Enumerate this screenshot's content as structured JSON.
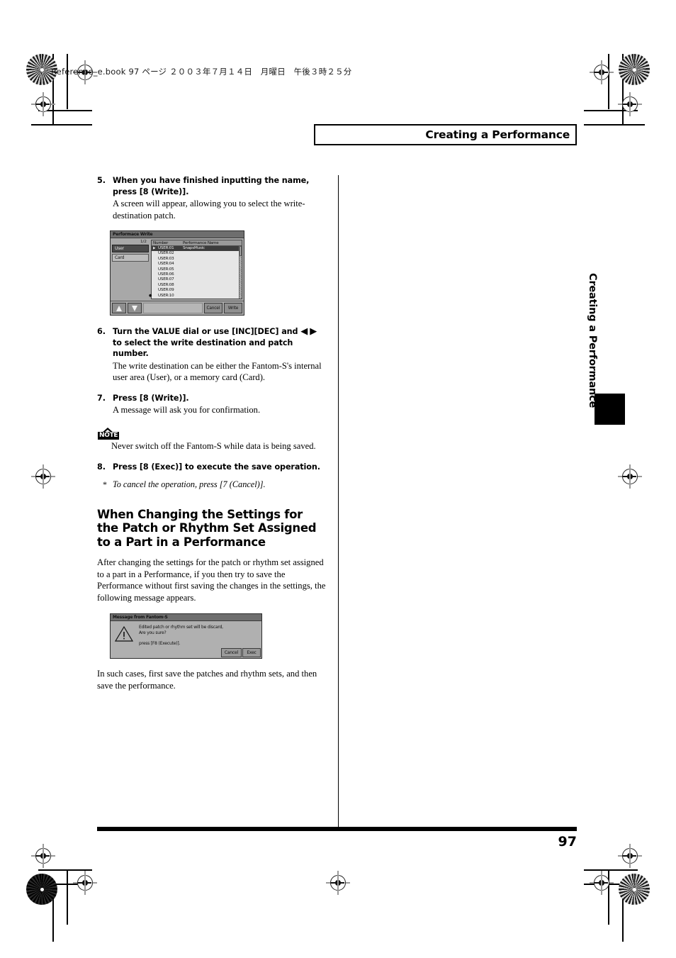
{
  "header": {
    "file_line": "Reference_e.book  97 ページ  ２００３年７月１４日　月曜日　午後３時２５分"
  },
  "running_title": "Creating a Performance",
  "side_tab": {
    "label": "Creating a Performance"
  },
  "footer": {
    "page_number": "97"
  },
  "steps": [
    {
      "num": "5.",
      "title": "When you have finished inputting the name, press [8 (Write)].",
      "desc": "A screen will appear, allowing you to select the write-destination patch."
    },
    {
      "num": "6.",
      "title_pre": "Turn the VALUE dial or use [INC][DEC] and",
      "title_post": "to select the write destination and patch number.",
      "tri_left": "◀",
      "tri_right": "▶",
      "desc": "The write destination can be either the Fantom-S's internal user area (User), or a memory card (Card)."
    },
    {
      "num": "7.",
      "title": "Press [8 (Write)].",
      "desc": "A message will ask you for confirmation."
    },
    {
      "num": "8.",
      "title": "Press [8 (Exec)] to execute the save operation.",
      "desc": ""
    }
  ],
  "note": {
    "badge_label": "NOTE",
    "text": "Never switch off the Fantom-S while data is being saved."
  },
  "cancel_note": {
    "marker": "*",
    "text": "To cancel the operation, press [7 (Cancel)]."
  },
  "section": {
    "heading": "When Changing the Settings for the Patch or Rhythm Set Assigned to a Part in a Performance",
    "paragraph": "After changing the settings for the patch or rhythm set assigned to a part in a Performance, if you then try to save the Performance without first saving the changes in the settings, the following message appears.",
    "closing": "In such cases, first save the patches and rhythm sets, and then save the performance."
  },
  "write_screen": {
    "title": "Performace Write",
    "page_indicator": "1/2",
    "tabs": [
      {
        "label": "User",
        "selected": true
      },
      {
        "label": "Card",
        "selected": false
      }
    ],
    "columns": [
      "Number",
      "Performance Name"
    ],
    "rows": [
      {
        "number": "USER:01",
        "name": "SnapsMusic",
        "selected": true
      },
      {
        "number": "USER:02",
        "name": "",
        "selected": false
      },
      {
        "number": "USER:03",
        "name": "",
        "selected": false
      },
      {
        "number": "USER:04",
        "name": "",
        "selected": false
      },
      {
        "number": "USER:05",
        "name": "",
        "selected": false
      },
      {
        "number": "USER:06",
        "name": "",
        "selected": false
      },
      {
        "number": "USER:07",
        "name": "",
        "selected": false
      },
      {
        "number": "USER:08",
        "name": "",
        "selected": false
      },
      {
        "number": "USER:09",
        "name": "",
        "selected": false
      },
      {
        "number": "USER:10",
        "name": "",
        "selected": false
      }
    ],
    "buttons": {
      "up": "up-arrow",
      "down": "down-arrow",
      "cancel": "Cancel",
      "write": "Write"
    }
  },
  "message_dialog": {
    "title": "Message from Fantom-S",
    "icon": "warning-triangle-icon",
    "line1": "Edited patch or rhythm set will be discard,",
    "line2": "Are you sure?",
    "line3": "press [F8 (Execute)].",
    "buttons": {
      "cancel": "Cancel",
      "exec": "Exec"
    }
  }
}
